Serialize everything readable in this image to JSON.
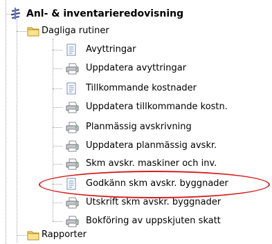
{
  "tree": {
    "root": {
      "label": "Anl- & inventarieredovisning",
      "icon": "module-icon"
    },
    "folders": [
      {
        "label": "Dagliga rutiner",
        "icon": "folder-icon"
      },
      {
        "label": "Rapporter",
        "icon": "folder-icon"
      }
    ],
    "items": [
      {
        "label": "Avyttringar",
        "icon": "document-icon"
      },
      {
        "label": "Uppdatera avyttringar",
        "icon": "printer-icon"
      },
      {
        "label": "Tillkommande kostnader",
        "icon": "document-icon"
      },
      {
        "label": "Uppdatera tillkommande kostn.",
        "icon": "printer-icon"
      },
      {
        "label": "Planmässig avskrivning",
        "icon": "printer-icon"
      },
      {
        "label": "Uppdatera planmässig avskr.",
        "icon": "printer-icon"
      },
      {
        "label": "Skm avskr. maskiner och inv.",
        "icon": "printer-icon"
      },
      {
        "label": "Godkänn skm avskr. byggnader",
        "icon": "document-icon",
        "highlighted": true
      },
      {
        "label": "Utskrift skm avskr. byggnader",
        "icon": "printer-icon"
      },
      {
        "label": "Bokföring av uppskjuten skatt",
        "icon": "printer-icon"
      }
    ]
  },
  "colors": {
    "highlight": "#d21e1e",
    "folder": "#f5cf5c",
    "tree_lines": "#a0a0a0"
  }
}
